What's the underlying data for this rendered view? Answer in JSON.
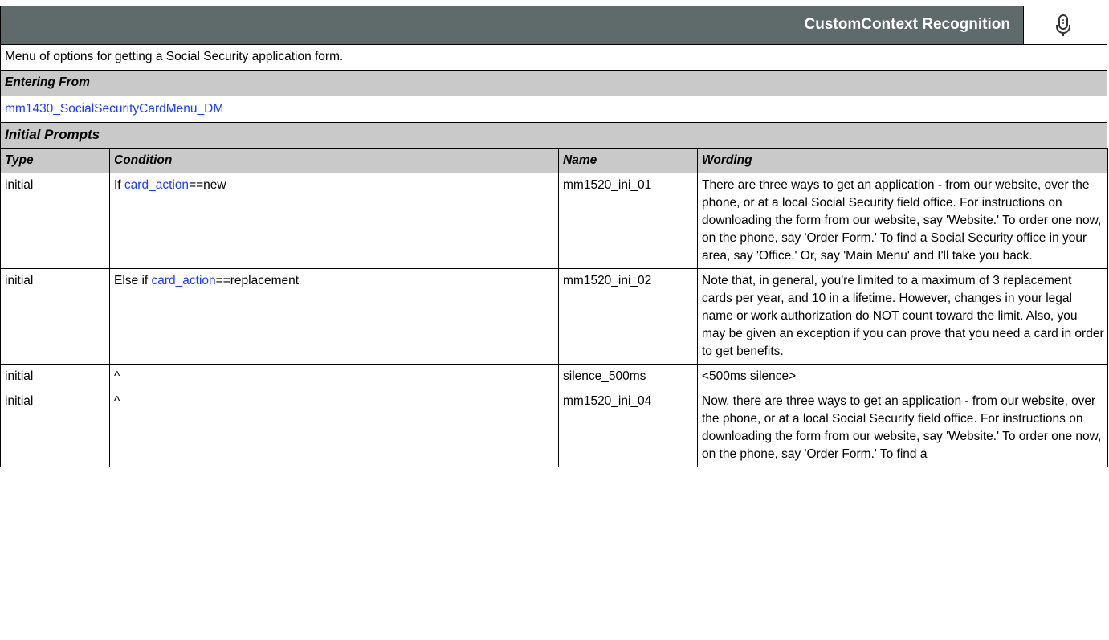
{
  "header": {
    "title": "CustomContext Recognition",
    "icon": "microphone-icon"
  },
  "description": "Menu of options for getting a Social Security application form.",
  "entering_from": {
    "label": "Entering From",
    "link": "mm1430_SocialSecurityCardMenu_DM"
  },
  "initial_prompts": {
    "label": "Initial Prompts",
    "columns": [
      "Type",
      "Condition",
      "Name",
      "Wording"
    ],
    "rows": [
      {
        "type": "initial",
        "cond_prefix": "If ",
        "cond_link": "card_action",
        "cond_suffix": "==new",
        "name": "mm1520_ini_01",
        "wording": "There are three ways to get an application - from our website, over the phone, or at a local Social Security field office. For instructions on downloading the form from our website, say 'Website.' To order one now, on the phone, say 'Order Form.' To find a Social Security office in your area, say 'Office.' Or, say 'Main Menu' and I'll take you back."
      },
      {
        "type": "initial",
        "cond_prefix": "Else if ",
        "cond_link": "card_action",
        "cond_suffix": "==replacement",
        "name": "mm1520_ini_02",
        "wording": "Note that, in general, you're limited to a maximum of 3 replacement cards per year, and 10 in a lifetime. However, changes in your legal name or work authorization do NOT count toward the limit. Also, you may be given an exception if you can prove that you need a card in order to get benefits."
      },
      {
        "type": "initial",
        "cond_prefix": "^",
        "cond_link": "",
        "cond_suffix": "",
        "name": "silence_500ms",
        "wording": "<500ms silence>"
      },
      {
        "type": "initial",
        "cond_prefix": "^",
        "cond_link": "",
        "cond_suffix": "",
        "name": "mm1520_ini_04",
        "wording": "Now, there are three ways to get an application - from our website, over the phone, or at a local Social Security field office. For instructions on downloading the form from our website, say 'Website.' To order one now, on the phone, say 'Order Form.' To find a"
      }
    ]
  }
}
